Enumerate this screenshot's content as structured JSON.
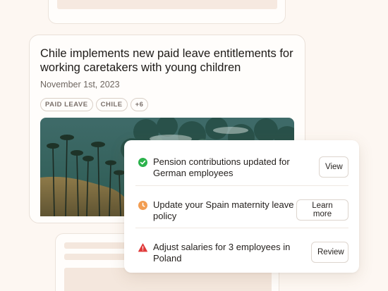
{
  "article": {
    "title": "Chile implements new paid leave entitlements for working caretakers with young children",
    "date": "November 1st, 2023",
    "tags": [
      "PAID LEAVE",
      "CHILE",
      "+6"
    ]
  },
  "notifications": [
    {
      "status": "success",
      "icon": "check-circle-icon",
      "color": "#2bb24c",
      "text": "Pension contributions updated for German employees",
      "action": "View"
    },
    {
      "status": "pending",
      "icon": "clock-icon",
      "color": "#f29d52",
      "text": "Update your Spain maternity leave policy",
      "action": "Learn more"
    },
    {
      "status": "warning",
      "icon": "warning-triangle-icon",
      "color": "#e03a3a",
      "text": "Adjust salaries for 3 employees in Poland",
      "action": "Review"
    }
  ]
}
